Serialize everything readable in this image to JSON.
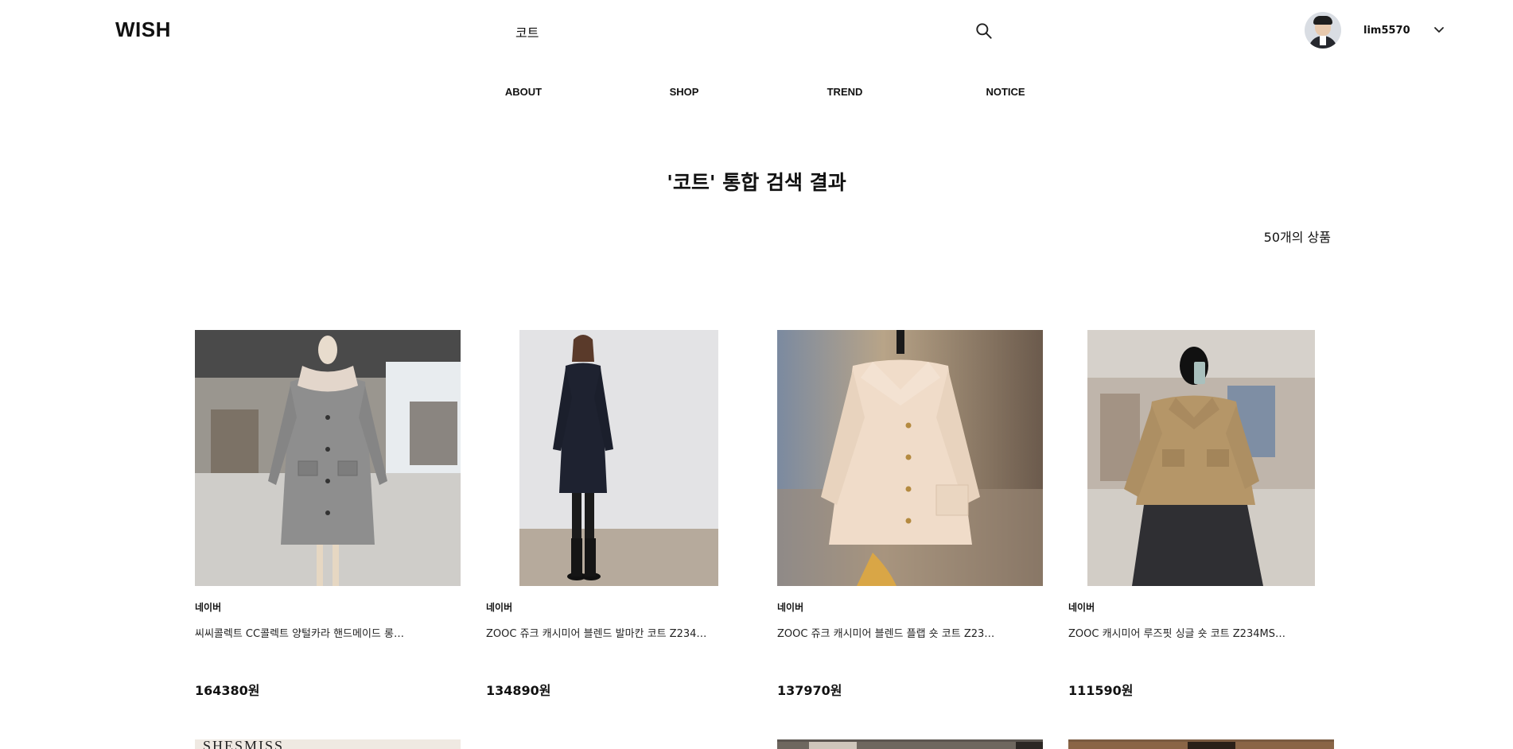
{
  "header": {
    "logo": "WISH",
    "search_value": "코트",
    "search_icon": "search-icon",
    "username": "lim5570",
    "dropdown_icon": "chevron-down-icon"
  },
  "nav": {
    "items": [
      "ABOUT",
      "SHOP",
      "TREND",
      "NOTICE"
    ]
  },
  "results": {
    "title": "'코트' 통합 검색 결과",
    "count": "50개의 상품"
  },
  "products": [
    {
      "mall": "네이버",
      "name": "씨씨콜렉트 CC콜렉트 양털카라 핸드메이드 롱…",
      "price": "164380원"
    },
    {
      "mall": "네이버",
      "name": "ZOOC 쥬크 캐시미어 블렌드 발마칸 코트 Z234…",
      "price": "134890원"
    },
    {
      "mall": "네이버",
      "name": "ZOOC 쥬크 캐시미어 블렌드 플랩 숏 코트 Z23…",
      "price": "137970원"
    },
    {
      "mall": "네이버",
      "name": "ZOOC 캐시미어 루즈핏 싱글 숏 코트 Z234MS…",
      "price": "111590원"
    }
  ],
  "second_row": {
    "partial_text": "SHESMISS"
  }
}
